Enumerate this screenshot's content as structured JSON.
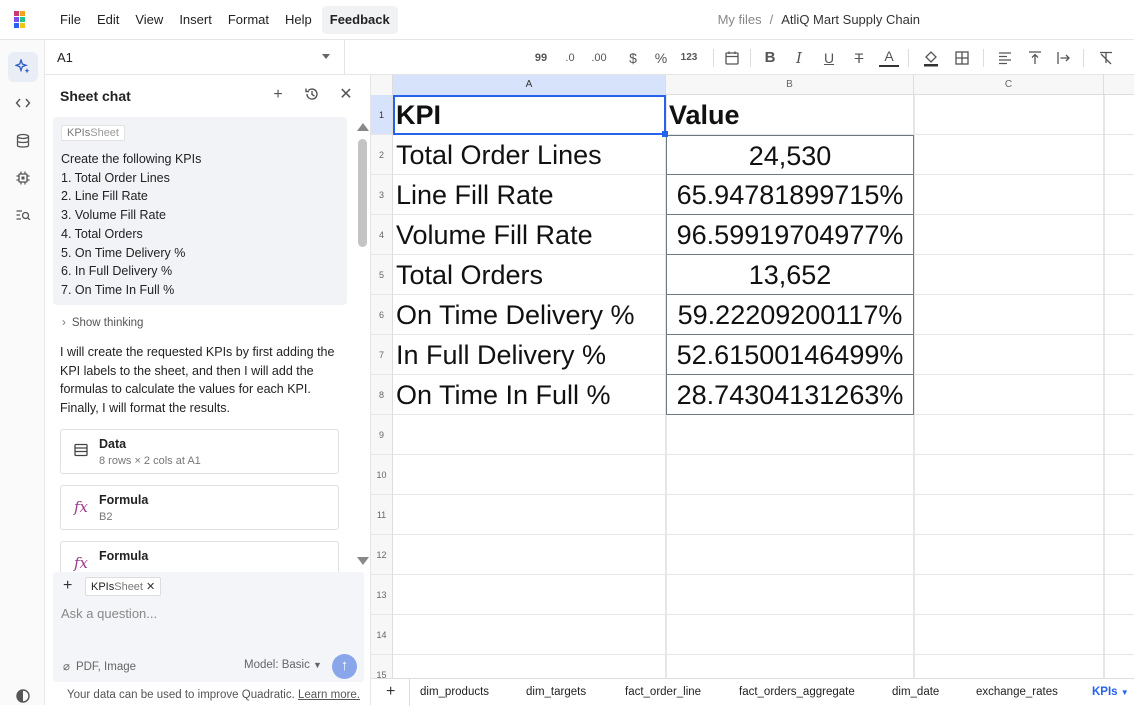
{
  "menu": [
    "File",
    "Edit",
    "View",
    "Insert",
    "Format",
    "Help"
  ],
  "feedback_label": "Feedback",
  "breadcrumb": {
    "root": "My files",
    "sep": "/",
    "file": "AtliQ Mart Supply Chain"
  },
  "namebox": {
    "ref": "A1"
  },
  "toolbar": {
    "decimal_more": "99",
    "decimal_less": ".0",
    "decimal_more2": ".00",
    "currency": "$",
    "percent": "%",
    "number": "123"
  },
  "chat": {
    "title": "Sheet chat",
    "context_tag": {
      "name": "KPIs",
      "suffix": "Sheet"
    },
    "prompt_lines": [
      "Create the following KPIs",
      "1. Total Order Lines",
      "2. Line Fill Rate",
      "3. Volume Fill Rate",
      "4. Total Orders",
      "5. On Time Delivery %",
      "6. In Full Delivery %",
      "7. On Time In Full %"
    ],
    "show_thinking": "Show thinking",
    "reply": "I will create the requested KPIs by first adding the KPI labels to the sheet, and then I will add the formulas to calculate the values for each KPI. Finally, I will format the results.",
    "tool_cards": [
      {
        "title": "Data",
        "sub": "8 rows × 2 cols at A1",
        "icon": "table-icon"
      },
      {
        "title": "Formula",
        "sub": "B2",
        "icon": "fx-icon"
      },
      {
        "title": "Formula",
        "sub": "",
        "icon": "fx-icon"
      }
    ],
    "composer": {
      "context_name": "KPIs",
      "context_suffix": "Sheet",
      "placeholder": "Ask a question...",
      "attach": "PDF, Image",
      "model": "Model: Basic"
    },
    "disclaimer": "Your data can be used to improve Quadratic.",
    "disclaimer_link": "Learn more."
  },
  "grid": {
    "columns": [
      "A",
      "B",
      "C"
    ],
    "selected_column": "A",
    "rows": [
      {
        "n": "1",
        "a": "KPI",
        "b": "Value",
        "header": true
      },
      {
        "n": "2",
        "a": "Total Order Lines",
        "b": "24,530"
      },
      {
        "n": "3",
        "a": "Line Fill Rate",
        "b": "65.94781899715%"
      },
      {
        "n": "4",
        "a": "Volume Fill Rate",
        "b": "96.59919704977%"
      },
      {
        "n": "5",
        "a": "Total Orders",
        "b": "13,652"
      },
      {
        "n": "6",
        "a": "On Time Delivery %",
        "b": "59.22209200117%"
      },
      {
        "n": "7",
        "a": "In Full Delivery %",
        "b": "52.61500146499%"
      },
      {
        "n": "8",
        "a": "On Time In Full %",
        "b": "28.74304131263%"
      },
      {
        "n": "9",
        "a": "",
        "b": ""
      },
      {
        "n": "10",
        "a": "",
        "b": ""
      },
      {
        "n": "11",
        "a": "",
        "b": ""
      },
      {
        "n": "12",
        "a": "",
        "b": ""
      },
      {
        "n": "13",
        "a": "",
        "b": ""
      },
      {
        "n": "14",
        "a": "",
        "b": ""
      },
      {
        "n": "15",
        "a": "",
        "b": ""
      }
    ]
  },
  "sheets": [
    "dim_products",
    "dim_targets",
    "fact_order_line",
    "fact_orders_aggregate",
    "dim_date",
    "exchange_rates",
    "KPIs"
  ],
  "active_sheet": "KPIs",
  "colors": {
    "accent": "#2563eb",
    "selected_header": "#d7e2fb"
  }
}
